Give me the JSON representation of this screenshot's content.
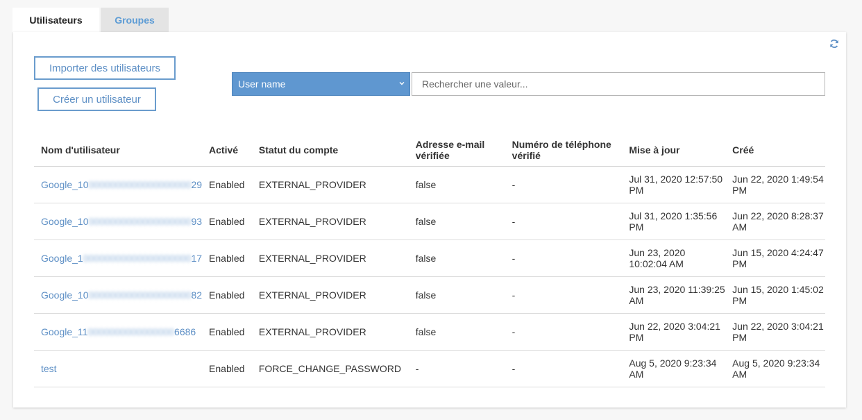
{
  "tabs": [
    {
      "label": "Utilisateurs",
      "active": true
    },
    {
      "label": "Groupes",
      "active": false
    }
  ],
  "actions": {
    "import_label": "Importer des utilisateurs",
    "create_label": "Créer un utilisateur"
  },
  "search": {
    "attribute_selected": "User name",
    "placeholder": "Rechercher une valeur..."
  },
  "table": {
    "headers": [
      "Nom d'utilisateur",
      "Activé",
      "Statut du compte",
      "Adresse e-mail vérifiée",
      "Numéro de téléphone vérifié",
      "Mise à jour",
      "Créé"
    ],
    "rows": [
      {
        "user_prefix": "Google_10",
        "user_masked": "0000000000000000000",
        "user_suffix": "29",
        "enabled": "Enabled",
        "status": "EXTERNAL_PROVIDER",
        "email_verified": "false",
        "phone_verified": "-",
        "updated": "Jul 31, 2020 12:57:50 PM",
        "created": "Jun 22, 2020 1:49:54 PM"
      },
      {
        "user_prefix": "Google_10",
        "user_masked": "0000000000000000000",
        "user_suffix": "93",
        "enabled": "Enabled",
        "status": "EXTERNAL_PROVIDER",
        "email_verified": "false",
        "phone_verified": "-",
        "updated": "Jul 31, 2020 1:35:56 PM",
        "created": "Jun 22, 2020 8:28:37 AM"
      },
      {
        "user_prefix": "Google_1",
        "user_masked": "00000000000000000000",
        "user_suffix": "17",
        "enabled": "Enabled",
        "status": "EXTERNAL_PROVIDER",
        "email_verified": "false",
        "phone_verified": "-",
        "updated": "Jun 23, 2020 10:02:04 AM",
        "created": "Jun 15, 2020 4:24:47 PM"
      },
      {
        "user_prefix": "Google_10",
        "user_masked": "0000000000000000000",
        "user_suffix": "82",
        "enabled": "Enabled",
        "status": "EXTERNAL_PROVIDER",
        "email_verified": "false",
        "phone_verified": "-",
        "updated": "Jun 23, 2020 11:39:25 AM",
        "created": "Jun 15, 2020 1:45:02 PM"
      },
      {
        "user_prefix": "Google_11",
        "user_masked": "0000000000000000",
        "user_suffix": "6686",
        "enabled": "Enabled",
        "status": "EXTERNAL_PROVIDER",
        "email_verified": "false",
        "phone_verified": "-",
        "updated": "Jun 22, 2020 3:04:21 PM",
        "created": "Jun 22, 2020 3:04:21 PM"
      },
      {
        "user_prefix": "test",
        "user_masked": "",
        "user_suffix": "",
        "enabled": "Enabled",
        "status": "FORCE_CHANGE_PASSWORD",
        "email_verified": "-",
        "phone_verified": "-",
        "updated": "Aug 5, 2020 9:23:34 AM",
        "created": "Aug 5, 2020 9:23:34 AM"
      }
    ]
  },
  "icons": {
    "refresh": "refresh-icon",
    "dropdown": "chevron-down-icon"
  },
  "colors": {
    "accent": "#5d8fc5",
    "select_bg": "#5f97d0"
  }
}
